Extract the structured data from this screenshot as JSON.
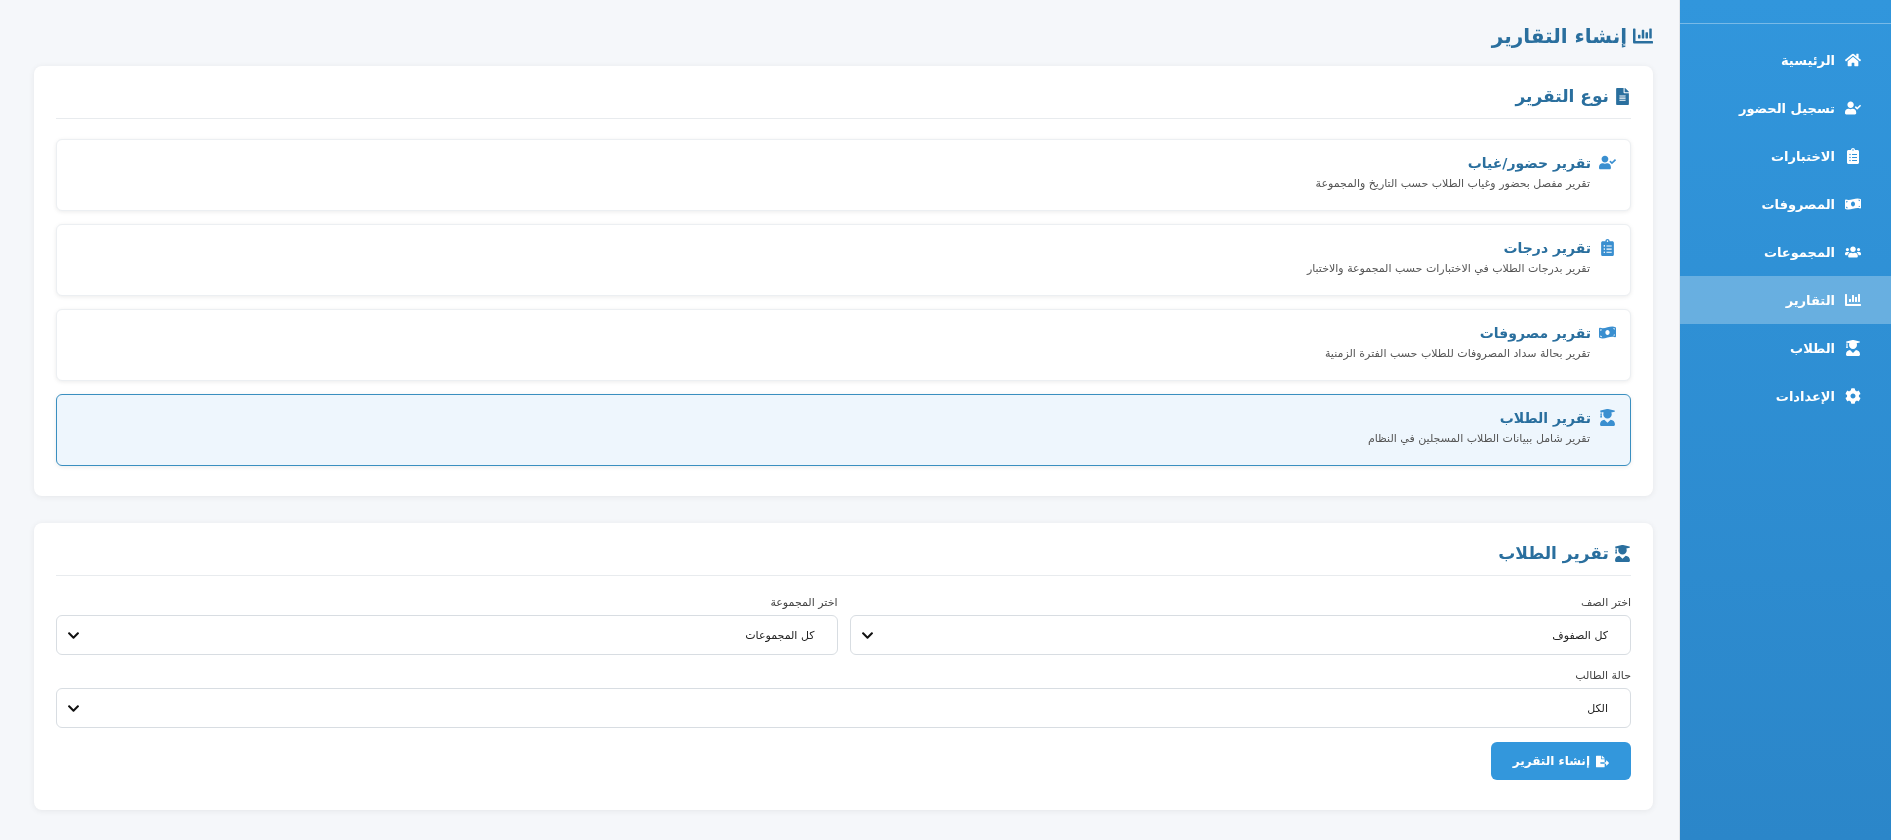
{
  "page_title": "إنشاء التقارير",
  "sidebar": {
    "items": [
      {
        "label": "الرئيسية",
        "selected": false
      },
      {
        "label": "تسجيل الحضور",
        "selected": false
      },
      {
        "label": "الاختبارات",
        "selected": false
      },
      {
        "label": "المصروفات",
        "selected": false
      },
      {
        "label": "المجموعات",
        "selected": false
      },
      {
        "label": "التقارير",
        "selected": true
      },
      {
        "label": "الطلاب",
        "selected": false
      },
      {
        "label": "الإعدادات",
        "selected": false
      }
    ]
  },
  "report_type": {
    "title": "نوع التقرير",
    "options": [
      {
        "title": "تقرير حضور/غياب",
        "description": "تقرير مفصل بحضور وغياب الطلاب حسب التاريخ والمجموعة",
        "selected": false
      },
      {
        "title": "تقرير درجات",
        "description": "تقرير بدرجات الطلاب في الاختبارات حسب المجموعة والاختبار",
        "selected": false
      },
      {
        "title": "تقرير مصروفات",
        "description": "تقرير بحالة سداد المصروفات للطلاب حسب الفترة الزمنية",
        "selected": false
      },
      {
        "title": "تقرير الطلاب",
        "description": "تقرير شامل ببيانات الطلاب المسجلين في النظام",
        "selected": true
      }
    ]
  },
  "report_form": {
    "title": "تقرير الطلاب",
    "rows": [
      [
        {
          "label": "اختر الصف",
          "value": "كل الصفوف"
        },
        {
          "label": "اختر المجموعة",
          "value": "كل المجموعات"
        }
      ],
      [
        {
          "label": "حالة الطالب",
          "value": "الكل"
        }
      ]
    ],
    "button": "إنشاء التقرير"
  }
}
